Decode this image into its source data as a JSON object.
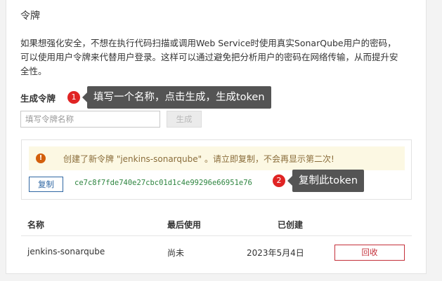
{
  "section": {
    "title": "令牌",
    "description": "如果想强化安全，不想在执行代码扫描或调用Web Service时使用真实SonarQube用户的密码，可以使用用户令牌来代替用户登录。这样可以通过避免把分析用户的密码在网络传输，从而提升安全性。"
  },
  "generate": {
    "label": "生成令牌",
    "input_placeholder": "填写令牌名称",
    "button_label": "生成"
  },
  "annotations": [
    {
      "number": "1",
      "text": "填写一个名称，点击生成，生成token"
    },
    {
      "number": "2",
      "text": "复制此token"
    }
  ],
  "new_token": {
    "alert_icon": "!",
    "alert_text": "创建了新令牌 \"jenkins-sonarqube\" 。请立即复制，不会再显示第二次!",
    "copy_label": "复制",
    "value": "ce7c8f7fde740e27cbc01d1c4e99296e66951e76"
  },
  "table": {
    "headers": {
      "name": "名称",
      "last_used": "最后使用",
      "created": "已创建"
    },
    "rows": [
      {
        "name": "jenkins-sonarqube",
        "last_used": "尚未",
        "created": "2023年5月4日",
        "action": "回收"
      }
    ]
  },
  "colors": {
    "badge": "#e02424",
    "tooltip": "#545454",
    "alert_bg": "#fcf8e3",
    "primary": "#2f67a3",
    "danger": "#c4303a",
    "token_text": "#2e8540"
  }
}
